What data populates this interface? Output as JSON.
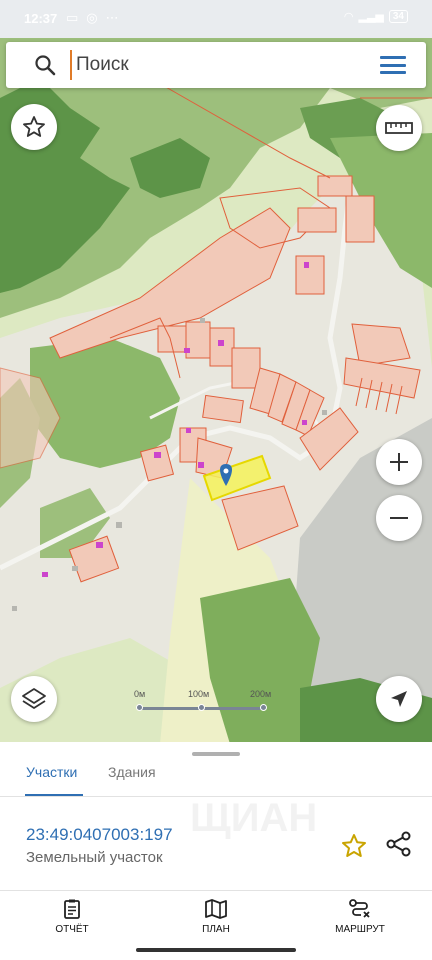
{
  "status_bar": {
    "time": "12:37",
    "battery": "34",
    "icons_left": [
      "message-icon",
      "whatsapp-icon",
      "more-icon"
    ],
    "icons_right": [
      "wifi-icon",
      "signal-icon",
      "battery-icon"
    ]
  },
  "search": {
    "placeholder": "Поиск",
    "value": ""
  },
  "map": {
    "scale_labels": [
      "0м",
      "100м",
      "200м"
    ],
    "colors": {
      "land": "#dde9c2",
      "forest": "#7fae5c",
      "dark_forest": "#5d9448",
      "parcel_fill": "#f2c9b8",
      "parcel_border": "#e0603c",
      "selected_parcel": "#f5f25a",
      "marker": "#2f6fb3",
      "building": "#cc44cc"
    }
  },
  "sheet": {
    "tabs": [
      "Участки",
      "Здания"
    ],
    "active_tab": "Участки",
    "parcel": {
      "cadastral_number": "23:49:0407003:197",
      "type": "Земельный участок"
    },
    "watermark": "ЩИАН"
  },
  "bottom_nav": [
    {
      "label": "ОТЧЁТ",
      "icon": "clipboard-icon"
    },
    {
      "label": "ПЛАН",
      "icon": "map-icon"
    },
    {
      "label": "МАРШРУТ",
      "icon": "route-icon"
    }
  ],
  "accent_color": "#2f6fb3"
}
